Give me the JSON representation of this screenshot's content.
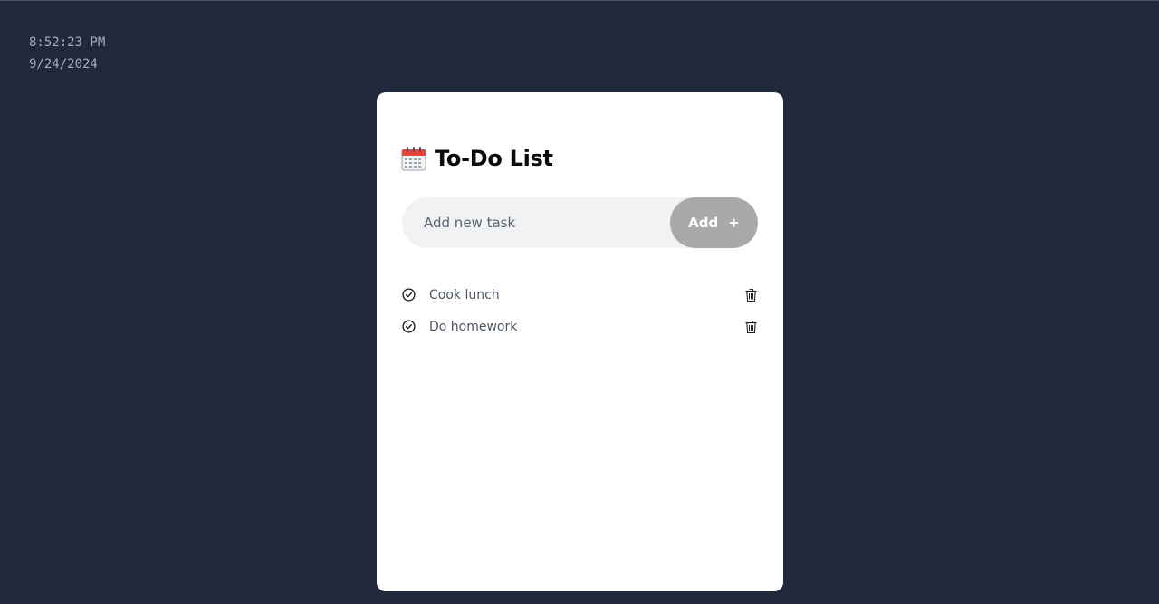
{
  "clock": {
    "time": "8:52:23 PM",
    "date": "9/24/2024"
  },
  "app": {
    "title": "To-Do List",
    "title_icon": "calendar-icon"
  },
  "input": {
    "placeholder": "Add new task",
    "value": ""
  },
  "add_button": {
    "label": "Add",
    "icon": "+"
  },
  "tasks": [
    {
      "text": "Cook lunch",
      "done": false
    },
    {
      "text": "Do homework",
      "done": false
    }
  ],
  "colors": {
    "background": "#1f293b",
    "card": "#ffffff",
    "input_bg": "#f1f2f4",
    "add_button": "#a9a9a9",
    "task_text": "#4b5563",
    "clock_text": "#a3adbb"
  }
}
